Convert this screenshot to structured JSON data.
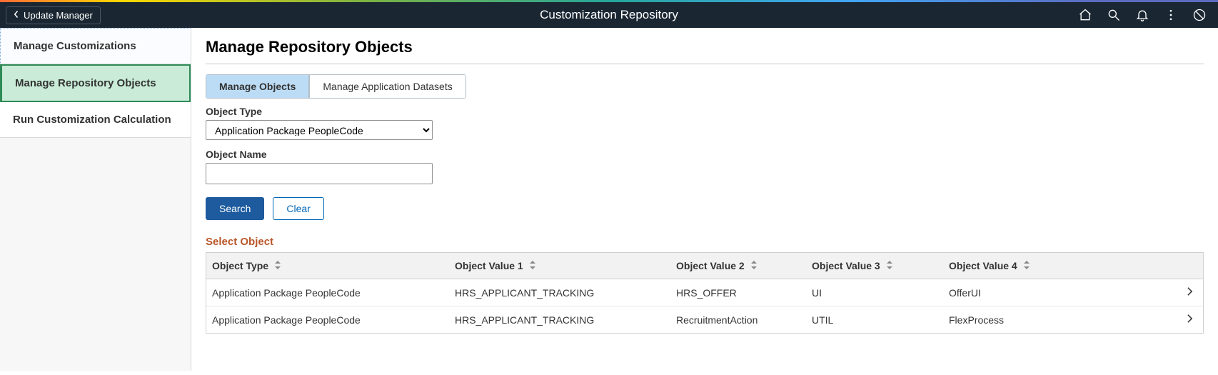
{
  "header": {
    "back_label": "Update Manager",
    "title": "Customization Repository"
  },
  "sidebar": {
    "items": [
      {
        "label": "Manage Customizations"
      },
      {
        "label": "Manage Repository Objects"
      },
      {
        "label": "Run Customization Calculation"
      }
    ]
  },
  "page": {
    "title": "Manage Repository Objects",
    "tabs": [
      {
        "label": "Manage Objects"
      },
      {
        "label": "Manage Application Datasets"
      }
    ],
    "object_type_label": "Object Type",
    "object_type_value": "Application Package PeopleCode",
    "object_name_label": "Object Name",
    "object_name_value": "",
    "search_btn": "Search",
    "clear_btn": "Clear",
    "select_object_title": "Select Object",
    "columns": {
      "c1": "Object Type",
      "c2": "Object Value 1",
      "c3": "Object Value 2",
      "c4": "Object Value 3",
      "c5": "Object Value 4"
    },
    "rows": [
      {
        "c1": "Application Package PeopleCode",
        "c2": "HRS_APPLICANT_TRACKING",
        "c3": "HRS_OFFER",
        "c4": "UI",
        "c5": "OfferUI"
      },
      {
        "c1": "Application Package PeopleCode",
        "c2": "HRS_APPLICANT_TRACKING",
        "c3": "RecruitmentAction",
        "c4": "UTIL",
        "c5": "FlexProcess"
      }
    ]
  }
}
